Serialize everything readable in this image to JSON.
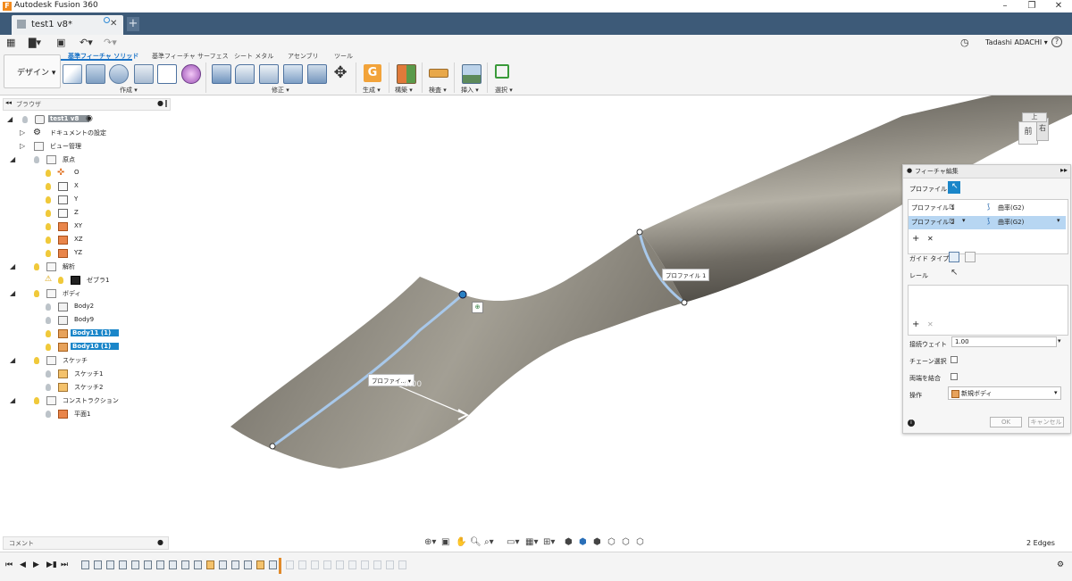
{
  "app": {
    "title": "Autodesk Fusion 360",
    "logo_letter": "F"
  },
  "window_controls": {
    "minimize": "–",
    "maximize": "❐",
    "close": "✕"
  },
  "document_tab": {
    "label": "test1 v8*",
    "close": "✕",
    "new_tab": "+"
  },
  "user": {
    "name": "Tadashi ADACHI ▾",
    "help": "?"
  },
  "workspace": {
    "label": "デザイン ▾"
  },
  "ribbon": {
    "tabs": [
      "基準フィーチャ ソリッド",
      "基準フィーチャ サーフェス",
      "シート メタル",
      "アセンブリ",
      "ツール"
    ],
    "groups": [
      "作成 ▾",
      "修正 ▾",
      "生成 ▾",
      "構築 ▾",
      "検査 ▾",
      "挿入 ▾",
      "選択 ▾"
    ],
    "accent": "#1a73c7"
  },
  "browser": {
    "title": "ブラウザ",
    "rows": [
      {
        "label": "test1 v8",
        "level": 0
      },
      {
        "label": "ドキュメントの設定",
        "level": 1
      },
      {
        "label": "ビュー管理",
        "level": 1
      },
      {
        "label": "原点",
        "level": 1
      },
      {
        "label": "O",
        "level": 2
      },
      {
        "label": "X",
        "level": 2
      },
      {
        "label": "Y",
        "level": 2
      },
      {
        "label": "Z",
        "level": 2
      },
      {
        "label": "XY",
        "level": 2
      },
      {
        "label": "XZ",
        "level": 2
      },
      {
        "label": "YZ",
        "level": 2
      },
      {
        "label": "解析",
        "level": 1
      },
      {
        "label": "ゼブラ1",
        "level": 2
      },
      {
        "label": "ボディ",
        "level": 1
      },
      {
        "label": "Body2",
        "level": 2
      },
      {
        "label": "Body9",
        "level": 2
      },
      {
        "label": "Body11 (1)",
        "level": 2
      },
      {
        "label": "Body10 (1)",
        "level": 2
      },
      {
        "label": "スケッチ",
        "level": 1
      },
      {
        "label": "スケッチ1",
        "level": 2
      },
      {
        "label": "スケッチ2",
        "level": 2
      },
      {
        "label": "コンストラクション",
        "level": 1
      },
      {
        "label": "平面1",
        "level": 2
      }
    ]
  },
  "comments": {
    "label": "コメント"
  },
  "viewport": {
    "tag_profile1": "プロファイル 1",
    "tag_profile_short": "プロファイ... ▾",
    "value_label": "0.00",
    "viewcube_front": "前",
    "viewcube_right": "右",
    "viewcube_top": "上"
  },
  "dialog": {
    "title": "フィーチャ編集",
    "profile_label": "プロファイル",
    "rows": [
      {
        "name": "プロファイル 1",
        "condition": "曲率(G2)"
      },
      {
        "name": "プロファイル 2",
        "condition": "曲率(G2)"
      }
    ],
    "add": "+",
    "remove": "✕",
    "guide_type_label": "ガイド タイプ",
    "rail_label": "レール",
    "tangent_weight_label": "接続ウェイト",
    "tangent_weight_value": "1.00",
    "chain_label": "チェーン選択",
    "merge_label": "両端を結合",
    "operation_label": "操作",
    "operation_value": "新規ボディ",
    "ok": "OK",
    "cancel": "キャンセル"
  },
  "status": {
    "selection": "2 Edges"
  }
}
